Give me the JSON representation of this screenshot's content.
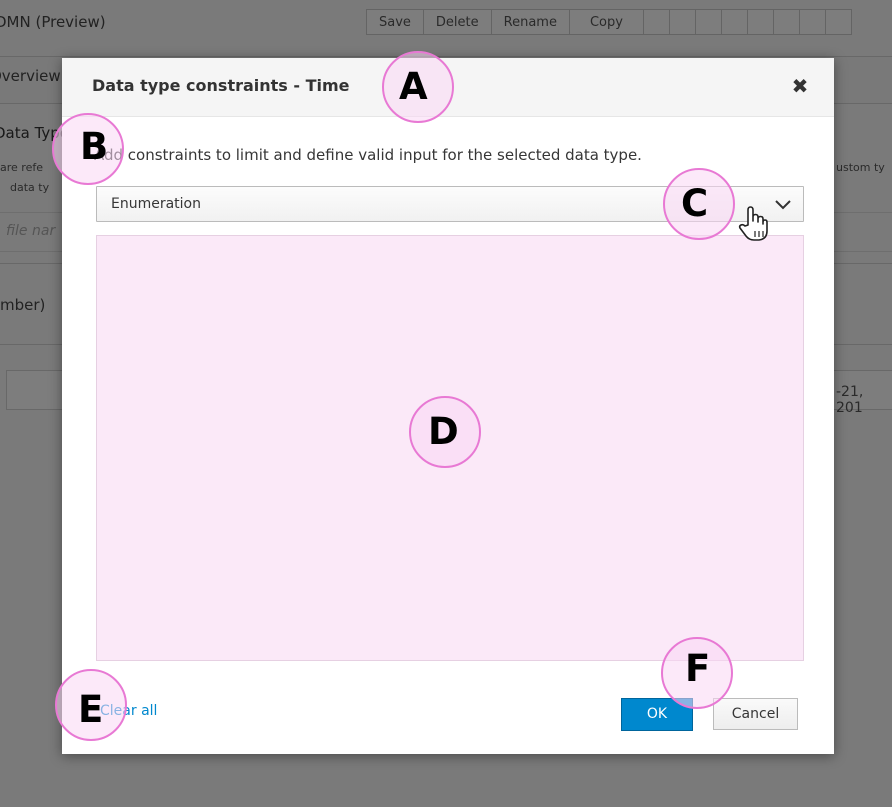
{
  "background": {
    "app_title": "DMN (Preview)",
    "toolbar": [
      "Save",
      "Delete",
      "Rename",
      "Copy"
    ],
    "overview_tab": "Overview",
    "section_title": "Data Types",
    "text_left_1": "are refe",
    "text_left_2": "data ty",
    "text_right_1": "ustom ty",
    "input_placeholder": "file nar",
    "number_label": "mber)",
    "date_text": "-21, 201"
  },
  "modal": {
    "title": "Data type constraints - Time",
    "instruction": "Add constraints to limit and define valid input for the selected data type.",
    "constraint_select": {
      "value": "Enumeration"
    },
    "clear_all_label": "Clear all",
    "ok_label": "OK",
    "cancel_label": "Cancel"
  },
  "callouts": [
    "A",
    "B",
    "C",
    "D",
    "E",
    "F"
  ],
  "colors": {
    "primary": "#0088ce",
    "callout_fill": "#fad7f4",
    "callout_border": "#e879d4",
    "constraint_area": "#fbe9f8"
  }
}
